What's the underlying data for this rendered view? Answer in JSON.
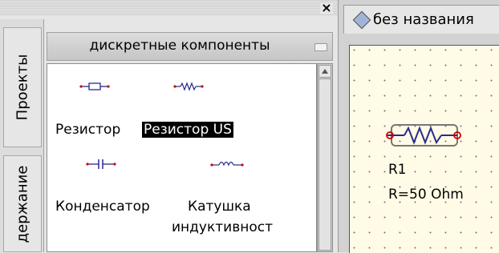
{
  "left_dock": {
    "close_glyph": "×",
    "tabs": [
      {
        "label": "Проекты"
      },
      {
        "label": "держание"
      }
    ],
    "group": {
      "title": "дискретные компоненты"
    },
    "components": [
      {
        "label": "Резистор",
        "icon": "resistor-icon",
        "selected": false
      },
      {
        "label": "Резистор US",
        "icon": "resistor-us-icon",
        "selected": true
      },
      {
        "label": "Конденсатор",
        "icon": "capacitor-icon",
        "selected": false
      },
      {
        "label_line1": "Катушка",
        "label_line2": "индуктивност",
        "icon": "inductor-icon",
        "selected": false
      }
    ]
  },
  "document": {
    "tab_title": "без названия",
    "tab_icon": "document-diamond-icon",
    "component": {
      "name": "R1",
      "value": "R=50 Ohm",
      "icon": "resistor-us-schematic-icon"
    }
  },
  "colors": {
    "selection_bg": "#000000",
    "canvas_bg": "#fffbe6",
    "wire": "#2a2a8c",
    "pin": "#d00000"
  }
}
